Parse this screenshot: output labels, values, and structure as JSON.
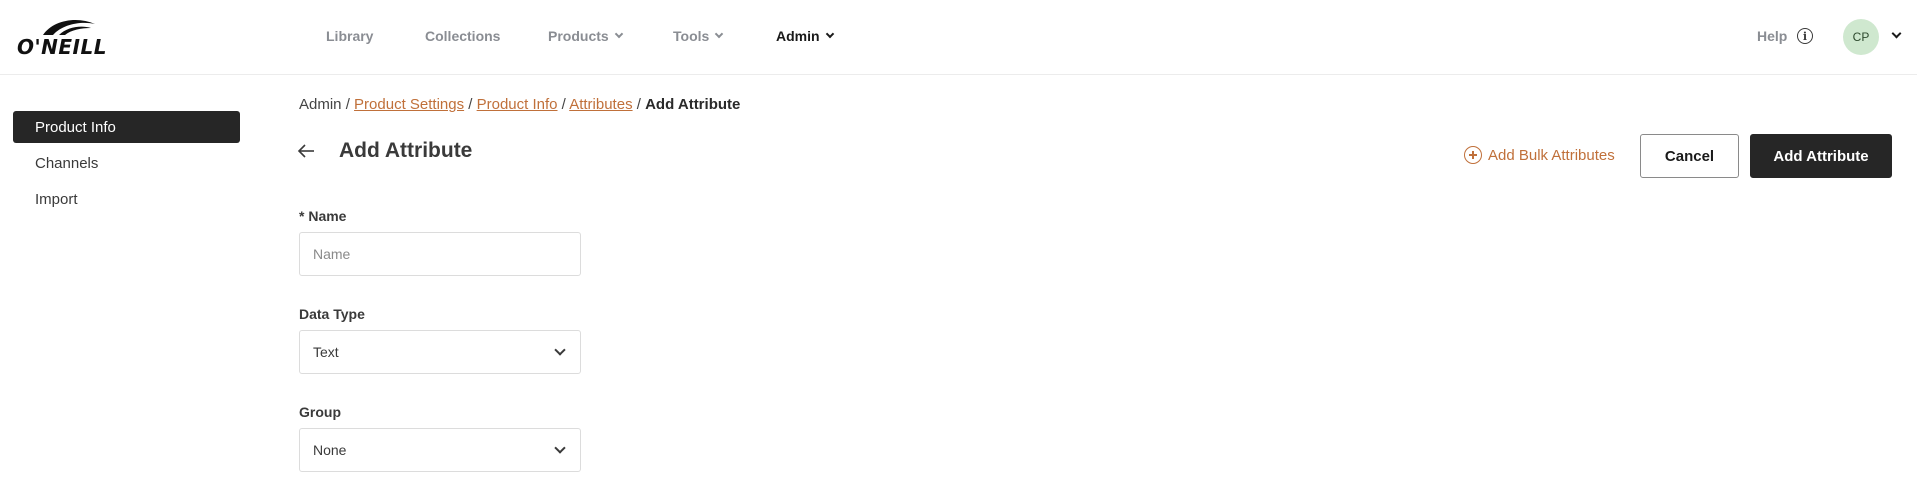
{
  "brand": {
    "logo_text": "O'NEILL"
  },
  "nav": {
    "items": [
      {
        "label": "Library"
      },
      {
        "label": "Collections"
      },
      {
        "label": "Products"
      },
      {
        "label": "Tools"
      },
      {
        "label": "Admin"
      }
    ],
    "help_label": "Help",
    "info_glyph": "i",
    "avatar_initials": "CP"
  },
  "sidebar": {
    "items": [
      {
        "label": "Product Info"
      },
      {
        "label": "Channels"
      },
      {
        "label": "Import"
      }
    ]
  },
  "breadcrumb": {
    "items": [
      {
        "label": "Admin"
      },
      {
        "label": "Product Settings"
      },
      {
        "label": "Product Info"
      },
      {
        "label": "Attributes"
      },
      {
        "label": "Add Attribute"
      }
    ],
    "separator": " / "
  },
  "page": {
    "title": "Add Attribute"
  },
  "actions": {
    "bulk_label": "Add Bulk Attributes",
    "cancel_label": "Cancel",
    "submit_label": "Add Attribute"
  },
  "form": {
    "name": {
      "label": "* Name",
      "placeholder": "Name",
      "value": ""
    },
    "data_type": {
      "label": "Data Type",
      "value": "Text"
    },
    "group": {
      "label": "Group",
      "value": "None"
    }
  },
  "colors": {
    "accent": "#c0703a",
    "dark": "#262626",
    "avatar_bg": "#cfe8cf"
  }
}
